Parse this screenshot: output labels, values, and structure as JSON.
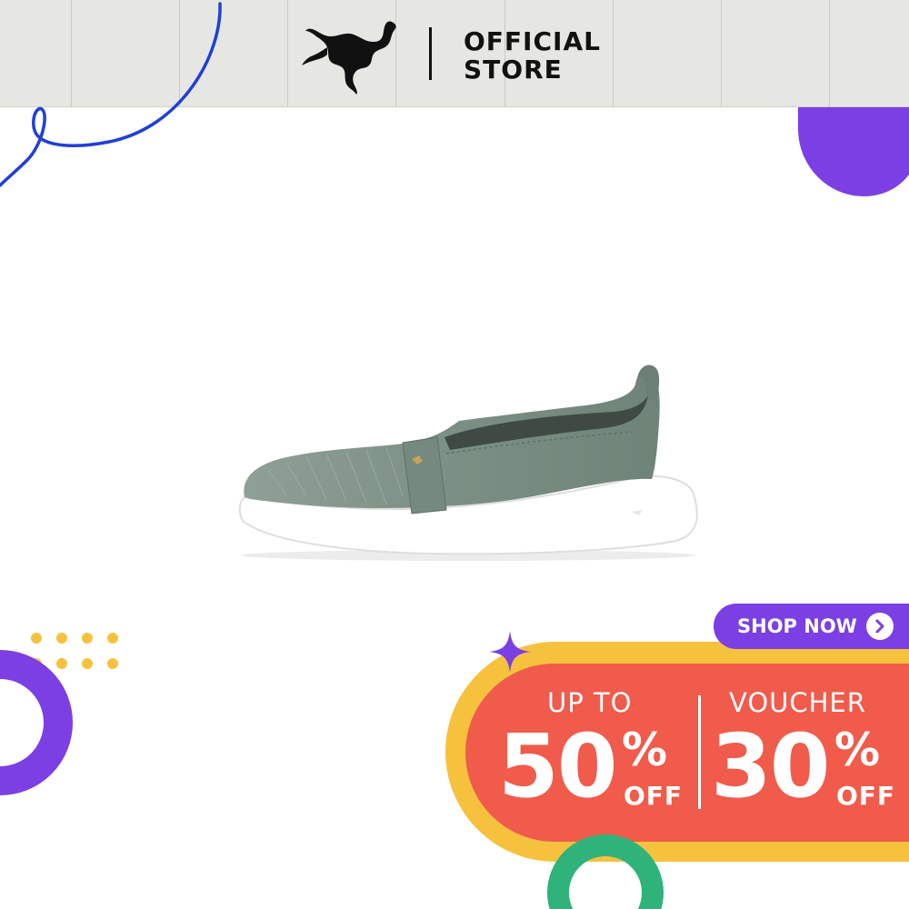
{
  "header": {
    "brand_icon": "puma-cat-icon",
    "store_line1": "OFFICIAL",
    "store_line2": "STORE"
  },
  "product": {
    "image_icon": "slip-on-shoe-image"
  },
  "cta": {
    "label": "SHOP NOW",
    "icon": "chevron-right-circle-icon"
  },
  "promo": {
    "left": {
      "top_text": "UP TO",
      "number": "50",
      "percent": "%",
      "off": "OFF"
    },
    "right": {
      "top_text": "VOUCHER",
      "number": "30",
      "percent": "%",
      "off": "OFF"
    }
  },
  "colors": {
    "header_bg": "#e6e6e3",
    "purple": "#7b3fe4",
    "blue_line": "#1f3fd6",
    "yellow": "#f6c23e",
    "coral": "#f05b4b",
    "green": "#2fb37b",
    "shoe_upper": "#7b8f84",
    "sole": "#ffffff"
  }
}
